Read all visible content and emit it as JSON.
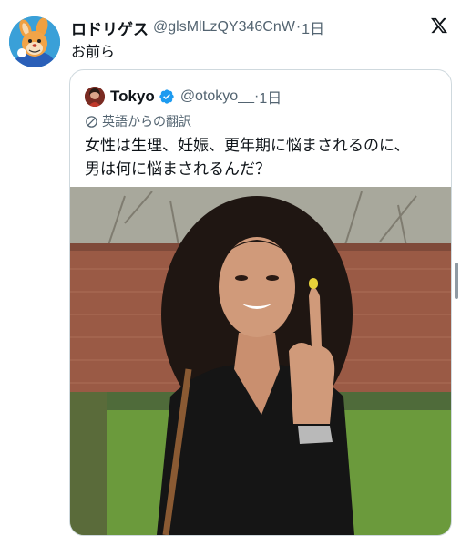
{
  "post": {
    "author_name": "ロドリゲス",
    "author_handle": "@glsMlLzQY346CnW",
    "separator": "·",
    "timestamp": "1日",
    "text": "お前ら",
    "avatar_icon": "cartoon-character-avatar-icon",
    "brand_icon": "x-logo-icon"
  },
  "quoted_post": {
    "author_name": "Tokyo",
    "verified": true,
    "author_handle": "@otokyo__",
    "separator": "·",
    "timestamp": "1日",
    "translated_label": "英語からの翻訳",
    "text_line1": "女性は生理、妊娠、更年期に悩まされるのに、",
    "text_line2": "男は何に悩まされるんだ？",
    "media_icon": "photo-image"
  },
  "colors": {
    "text_primary": "#0f1419",
    "text_secondary": "#536471",
    "verified_blue": "#1d9bf0",
    "card_border": "#cfd9de"
  }
}
